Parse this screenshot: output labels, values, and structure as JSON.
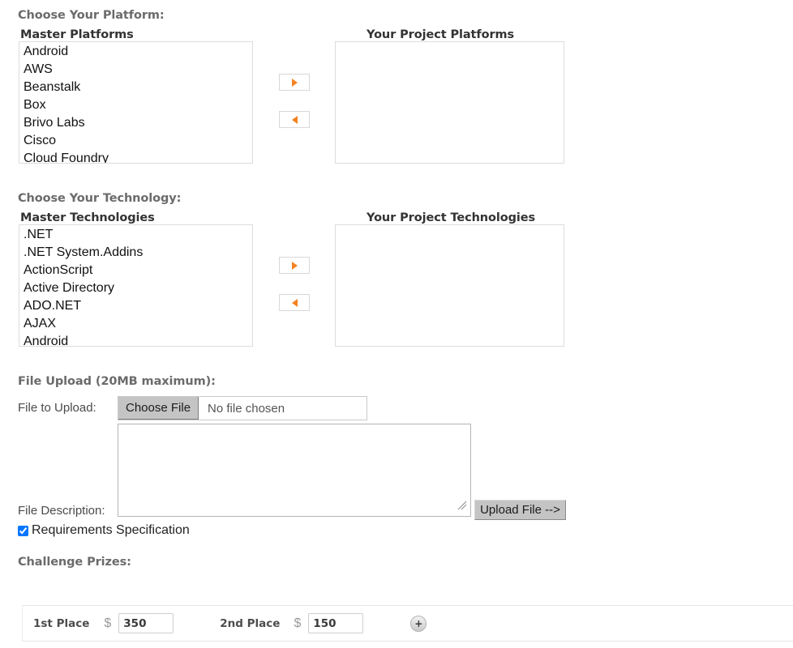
{
  "platform_section": {
    "heading": "Choose Your Platform:",
    "master_label": "Master Platforms",
    "project_label": "Your Project Platforms",
    "master_items": [
      "Android",
      "AWS",
      "Beanstalk",
      "Box",
      "Brivo Labs",
      "Cisco",
      "Cloud Foundry"
    ],
    "project_items": [],
    "add_icon": "triangle-right-icon",
    "remove_icon": "triangle-left-icon"
  },
  "technology_section": {
    "heading": "Choose Your Technology:",
    "master_label": "Master Technologies",
    "project_label": "Your Project Technologies",
    "master_items": [
      ".NET",
      ".NET System.Addins",
      "ActionScript",
      "Active Directory",
      "ADO.NET",
      "AJAX",
      "Android"
    ],
    "project_items": [],
    "add_icon": "triangle-right-icon",
    "remove_icon": "triangle-left-icon"
  },
  "file_upload": {
    "heading": "File Upload (20MB maximum):",
    "file_label": "File to Upload:",
    "choose_file_button": "Choose File",
    "file_status": "No file chosen",
    "description_label": "File Description:",
    "description_value": "",
    "upload_button": "Upload File -->",
    "checkbox_label": "Requirements Specification",
    "checkbox_checked": true
  },
  "prizes": {
    "heading": "Challenge Prizes:",
    "currency_symbol": "$",
    "rows": [
      {
        "first_place_label": "1st Place",
        "first_place_value": "350",
        "second_place_label": "2nd Place",
        "second_place_value": "150",
        "add_row_icon": "plus-icon"
      }
    ]
  },
  "colors": {
    "accent_orange": "#f58220",
    "heading_gray": "#6b6b6b",
    "border_gray": "#dcdcdc",
    "button_gray": "#c4c4c4"
  }
}
